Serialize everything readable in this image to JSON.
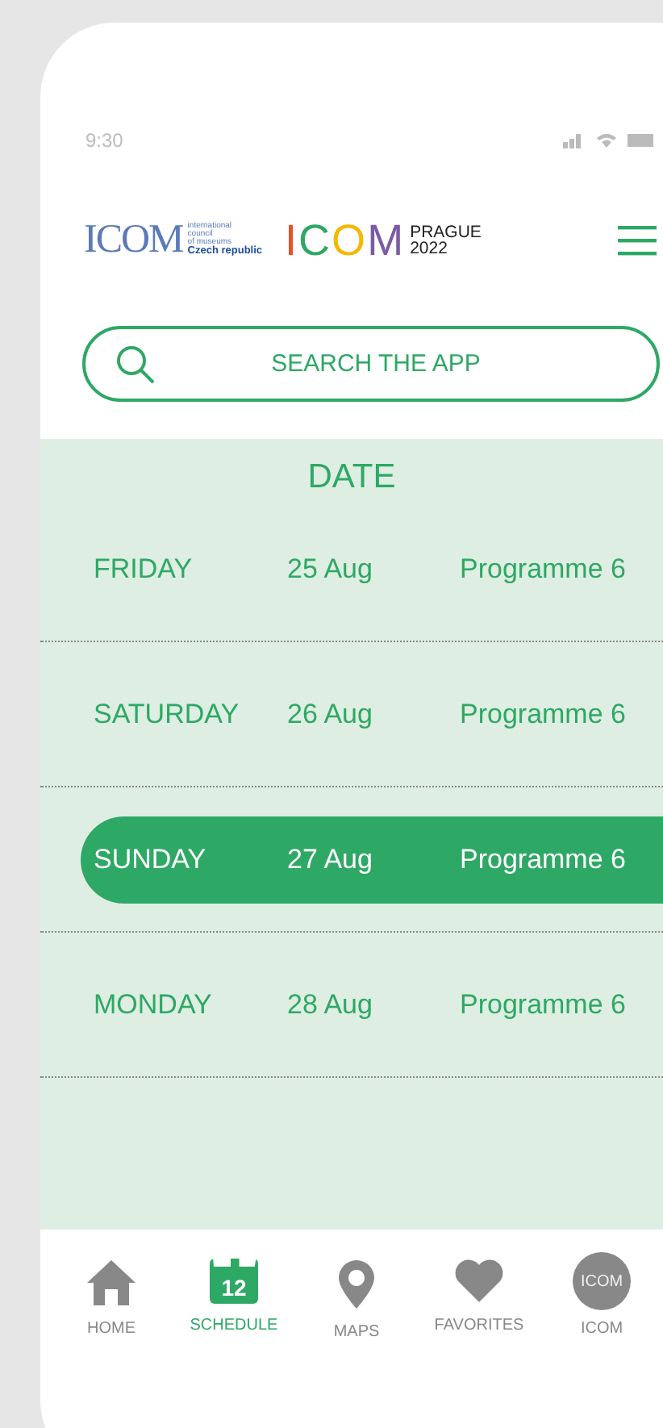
{
  "status_bar": {
    "time": "9:30"
  },
  "header": {
    "logo_cz": {
      "mark": "ICOM",
      "small_lines": [
        "international",
        "council",
        "of museums"
      ],
      "country": "Czech republic"
    },
    "logo_prague": {
      "letters": [
        {
          "char": "I",
          "color": "#e8502a"
        },
        {
          "char": "C",
          "color": "#2ea865"
        },
        {
          "char": "O",
          "color": "#f5b800"
        },
        {
          "char": "M",
          "color": "#7b5aa6"
        }
      ],
      "city": "PRAGUE",
      "year": "2022"
    }
  },
  "search": {
    "placeholder": "SEARCH THE APP"
  },
  "schedule": {
    "title": "DATE",
    "rows": [
      {
        "day": "FRIDAY",
        "date": "25 Aug",
        "programme": "Programme 6",
        "selected": false
      },
      {
        "day": "SATURDAY",
        "date": "26 Aug",
        "programme": "Programme 6",
        "selected": false
      },
      {
        "day": "SUNDAY",
        "date": "27 Aug",
        "programme": "Programme 6",
        "selected": true
      },
      {
        "day": "MONDAY",
        "date": "28 Aug",
        "programme": "Programme 6",
        "selected": false
      }
    ]
  },
  "nav": [
    {
      "kind": "home",
      "label": "HOME",
      "selected": false
    },
    {
      "kind": "calendar",
      "label": "SCHEDULE",
      "selected": true,
      "icon_text": "12"
    },
    {
      "kind": "pin",
      "label": "MAPS",
      "selected": false
    },
    {
      "kind": "heart",
      "label": "FAVORITES",
      "selected": false
    },
    {
      "kind": "badge",
      "label": "ICOM",
      "selected": false,
      "icon_text": "ICOM"
    }
  ]
}
